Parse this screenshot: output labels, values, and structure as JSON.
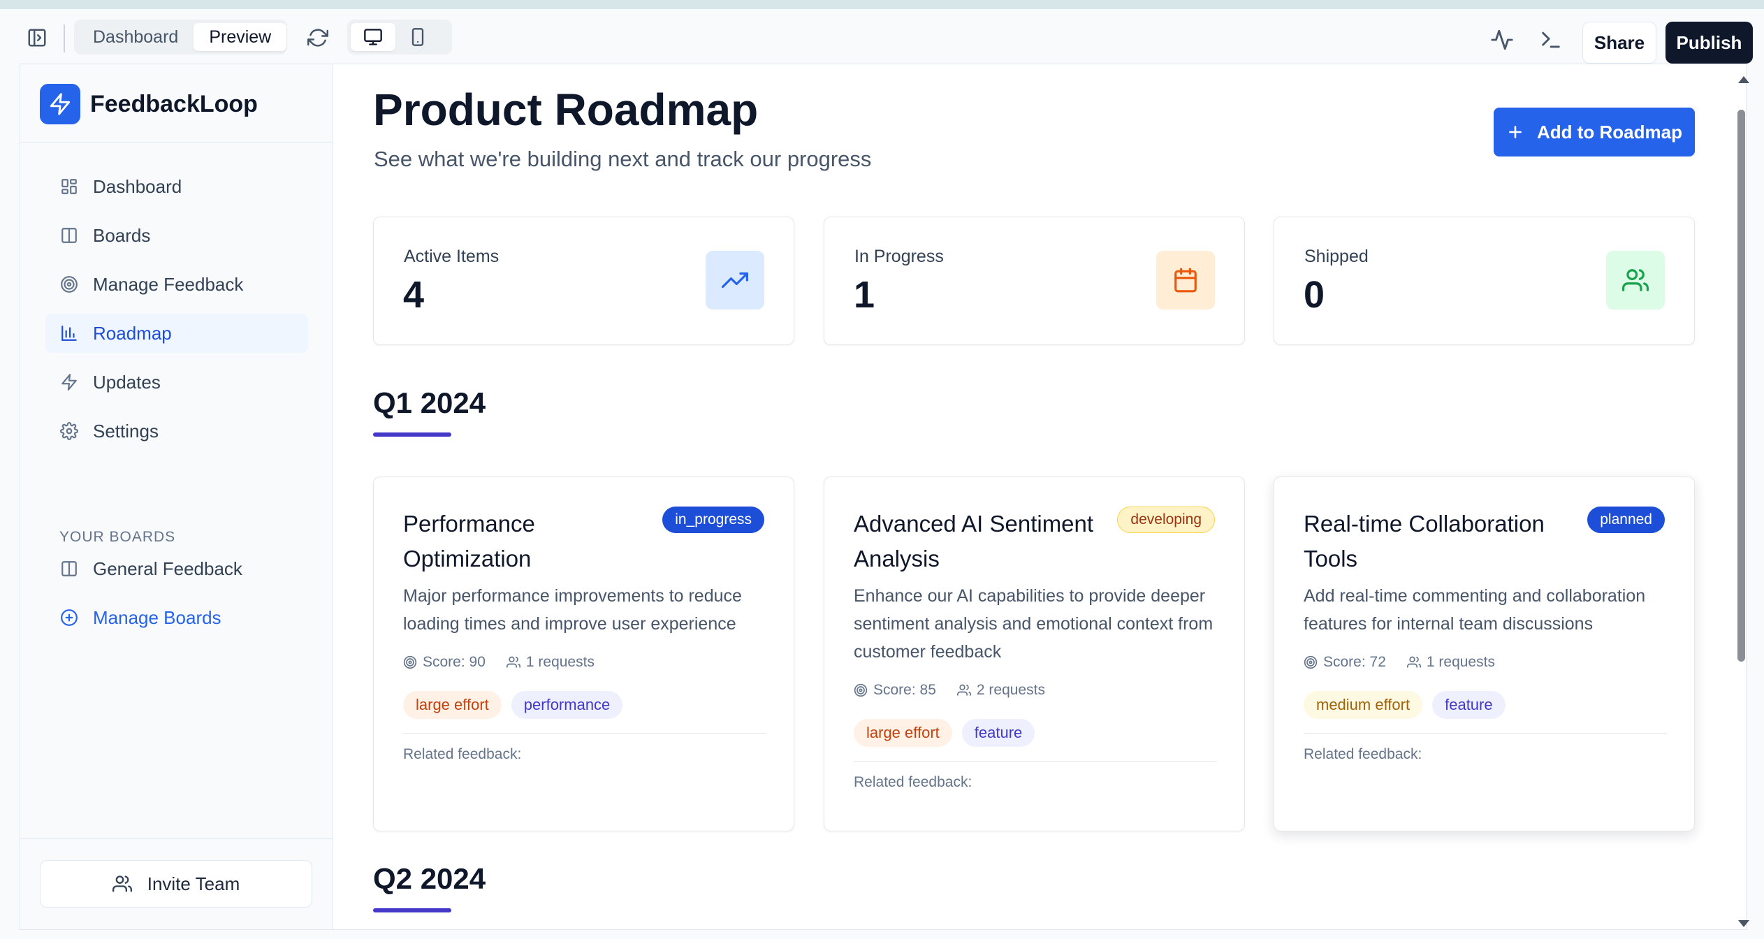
{
  "toolbar": {
    "view_tabs": [
      "Dashboard",
      "Preview"
    ],
    "active_view": "Preview",
    "share_label": "Share",
    "publish_label": "Publish"
  },
  "sidebar": {
    "brand": "FeedbackLoop",
    "nav": [
      {
        "label": "Dashboard",
        "icon": "grid-icon"
      },
      {
        "label": "Boards",
        "icon": "columns-icon"
      },
      {
        "label": "Manage Feedback",
        "icon": "target-icon"
      },
      {
        "label": "Roadmap",
        "icon": "bar-chart-icon",
        "active": true
      },
      {
        "label": "Updates",
        "icon": "zap-icon"
      },
      {
        "label": "Settings",
        "icon": "gear-icon"
      }
    ],
    "boards_heading": "YOUR BOARDS",
    "boards": [
      {
        "label": "General Feedback",
        "icon": "columns-icon"
      },
      {
        "label": "Manage Boards",
        "icon": "plus-circle-icon"
      }
    ],
    "invite_label": "Invite Team"
  },
  "main": {
    "title": "Product Roadmap",
    "subtitle": "See what we're building next and track our progress",
    "add_label": "Add to Roadmap",
    "stats": [
      {
        "label": "Active Items",
        "value": "4",
        "icon": "trending-up-icon",
        "color": "#2563eb",
        "bg": "#dbeafe"
      },
      {
        "label": "In Progress",
        "value": "1",
        "icon": "calendar-icon",
        "color": "#ea580c",
        "bg": "#ffedd5"
      },
      {
        "label": "Shipped",
        "value": "0",
        "icon": "users-icon",
        "color": "#16a34a",
        "bg": "#dcfce7"
      }
    ],
    "quarters": [
      "Q1 2024",
      "Q2 2024"
    ],
    "cards": [
      {
        "title": "Performance Optimization",
        "status": "in_progress",
        "description": "Major performance improvements to reduce loading times and improve user experience",
        "score": "Score: 90",
        "requests": "1 requests",
        "tags": [
          "large effort",
          "performance"
        ],
        "related": "Related feedback:"
      },
      {
        "title": "Advanced AI Sentiment Analysis",
        "status": "developing",
        "description": "Enhance our AI capabilities to provide deeper sentiment analysis and emotional context from customer feedback",
        "score": "Score: 85",
        "requests": "2 requests",
        "tags": [
          "large effort",
          "feature"
        ],
        "related": "Related feedback:"
      },
      {
        "title": "Real-time Collaboration Tools",
        "status": "planned",
        "description": "Add real-time commenting and collaboration features for internal team discussions",
        "score": "Score: 72",
        "requests": "1 requests",
        "tags": [
          "medium effort",
          "feature"
        ],
        "related": "Related feedback:"
      }
    ]
  },
  "colors": {
    "accent": "#2563eb",
    "publish": "#0f172a",
    "quarter_bar": "#4338ca"
  }
}
